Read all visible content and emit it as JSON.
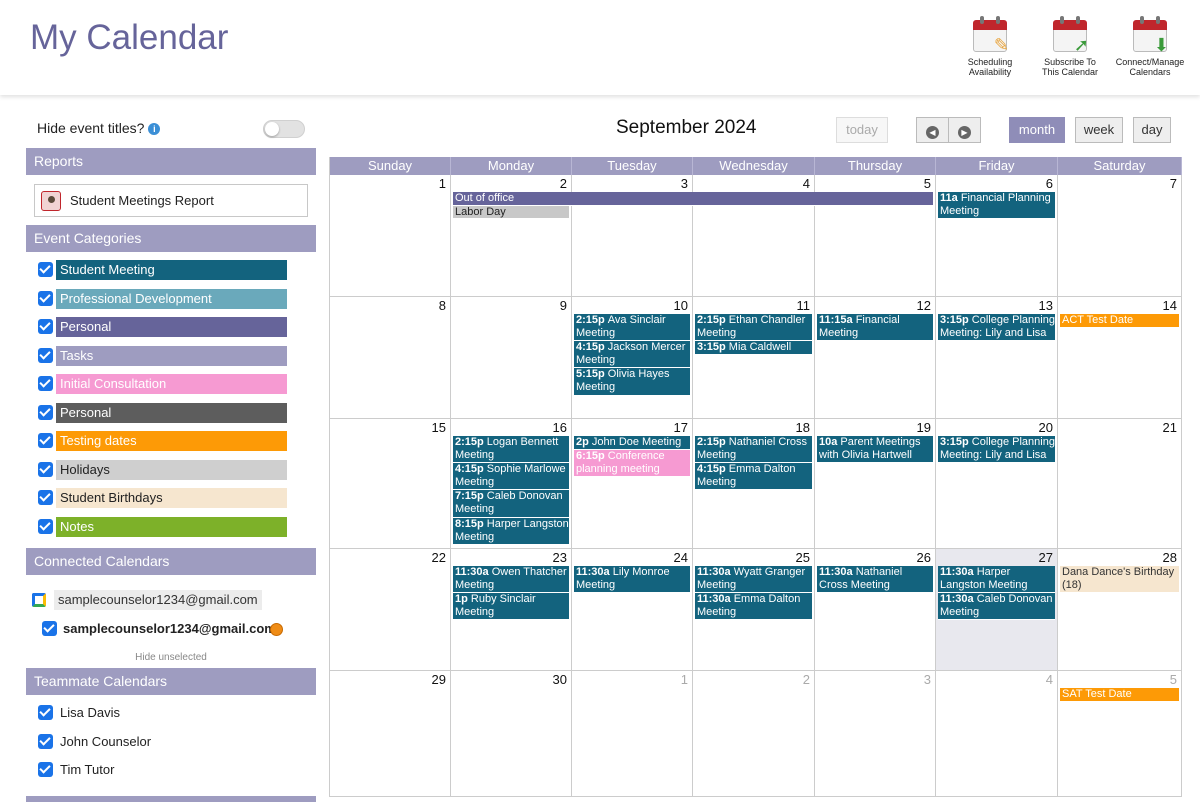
{
  "header": {
    "title": "My Calendar",
    "buttons": [
      {
        "label_line1": "Scheduling",
        "label_line2": "Availability",
        "icon": "calendar-pencil-icon"
      },
      {
        "label_line1": "Subscribe To",
        "label_line2": "This Calendar",
        "icon": "calendar-arrow-icon"
      },
      {
        "label_line1": "Connect/Manage",
        "label_line2": "Calendars",
        "icon": "calendar-download-icon"
      }
    ]
  },
  "sidebar": {
    "hide_titles_label": "Hide event titles?",
    "reports_header": "Reports",
    "report_item": "Student Meetings Report",
    "categories_header": "Event Categories",
    "categories": [
      {
        "label": "Student Meeting",
        "color": "#13637e"
      },
      {
        "label": "Professional Development",
        "color": "#6aa9bb"
      },
      {
        "label": "Personal",
        "color": "#66649a"
      },
      {
        "label": "Tasks",
        "color": "#9e9cc0"
      },
      {
        "label": "Initial Consultation",
        "color": "#f69ad2"
      },
      {
        "label": "Personal",
        "color": "#5d5d5d"
      },
      {
        "label": "Testing dates",
        "color": "#fd9a06"
      },
      {
        "label": "Holidays",
        "color": "#cfcfcf"
      },
      {
        "label": "Student Birthdays",
        "color": "#f6e6cf"
      },
      {
        "label": "Notes",
        "color": "#7db129"
      }
    ],
    "connected_header": "Connected Calendars",
    "connected_account": "samplecounselor1234@gmail.com",
    "connected_sub": "samplecounselor1234@gmail.com",
    "hide_unselected": "Hide unselected",
    "teammate_header": "Teammate Calendars",
    "teammates": [
      "Lisa Davis",
      "John Counselor",
      "Tim Tutor"
    ]
  },
  "calendar": {
    "title": "September 2024",
    "today_label": "today",
    "views": {
      "month": "month",
      "week": "week",
      "day": "day"
    },
    "days_of_week": [
      "Sunday",
      "Monday",
      "Tuesday",
      "Wednesday",
      "Thursday",
      "Friday",
      "Saturday"
    ],
    "weeks": [
      [
        "1",
        "2",
        "3",
        "4",
        "5",
        "6",
        "7"
      ],
      [
        "8",
        "9",
        "10",
        "11",
        "12",
        "13",
        "14"
      ],
      [
        "15",
        "16",
        "17",
        "18",
        "19",
        "20",
        "21"
      ],
      [
        "22",
        "23",
        "24",
        "25",
        "26",
        "27",
        "28"
      ],
      [
        "29",
        "30",
        "1",
        "2",
        "3",
        "4",
        "5"
      ]
    ],
    "events": [
      {
        "week": 0,
        "day": 1,
        "span": 4,
        "slot": 0,
        "lines": 1,
        "time": "",
        "title": "Out of office",
        "cls": "purple"
      },
      {
        "week": 0,
        "day": 1,
        "span": 1,
        "slot": 1,
        "lines": 1,
        "time": "",
        "title": "Labor Day",
        "cls": "gray"
      },
      {
        "week": 0,
        "day": 5,
        "span": 1,
        "slot": 0,
        "lines": 2,
        "time": "11a",
        "title": "Financial Planning Meeting",
        "cls": "teal"
      },
      {
        "week": 1,
        "day": 2,
        "span": 1,
        "slot": 0,
        "lines": 2,
        "time": "2:15p",
        "title": "Ava Sinclair Meeting",
        "cls": "teal"
      },
      {
        "week": 1,
        "day": 2,
        "span": 1,
        "slot": 2,
        "lines": 2,
        "time": "4:15p",
        "title": "Jackson Mercer Meeting",
        "cls": "teal"
      },
      {
        "week": 1,
        "day": 2,
        "span": 1,
        "slot": 4,
        "lines": 2,
        "time": "5:15p",
        "title": "Olivia Hayes Meeting",
        "cls": "teal"
      },
      {
        "week": 1,
        "day": 3,
        "span": 1,
        "slot": 0,
        "lines": 2,
        "time": "2:15p",
        "title": "Ethan Chandler Meeting",
        "cls": "teal"
      },
      {
        "week": 1,
        "day": 3,
        "span": 1,
        "slot": 2,
        "lines": 1,
        "time": "3:15p",
        "title": "Mia Caldwell",
        "cls": "teal"
      },
      {
        "week": 1,
        "day": 4,
        "span": 1,
        "slot": 0,
        "lines": 2,
        "time": "11:15a",
        "title": "Financial Meeting",
        "cls": "teal"
      },
      {
        "week": 1,
        "day": 5,
        "span": 1,
        "slot": 0,
        "lines": 2,
        "time": "3:15p",
        "title": "College Planning Meeting: Lily and Lisa",
        "cls": "teal"
      },
      {
        "week": 1,
        "day": 6,
        "span": 1,
        "slot": 0,
        "lines": 1,
        "time": "",
        "title": "ACT Test Date",
        "cls": "orange"
      },
      {
        "week": 2,
        "day": 1,
        "span": 1,
        "slot": 0,
        "lines": 2,
        "time": "2:15p",
        "title": "Logan Bennett Meeting",
        "cls": "teal"
      },
      {
        "week": 2,
        "day": 1,
        "span": 1,
        "slot": 2,
        "lines": 2,
        "time": "4:15p",
        "title": "Sophie Marlowe Meeting",
        "cls": "teal"
      },
      {
        "week": 2,
        "day": 1,
        "span": 1,
        "slot": 4,
        "lines": 2,
        "time": "7:15p",
        "title": "Caleb Donovan Meeting",
        "cls": "teal"
      },
      {
        "week": 2,
        "day": 1,
        "span": 1,
        "slot": 6,
        "lines": 2,
        "time": "8:15p",
        "title": "Harper Langston Meeting",
        "cls": "teal"
      },
      {
        "week": 2,
        "day": 2,
        "span": 1,
        "slot": 0,
        "lines": 1,
        "time": "2p",
        "title": "John Doe Meeting",
        "cls": "teal"
      },
      {
        "week": 2,
        "day": 2,
        "span": 1,
        "slot": 1,
        "lines": 2,
        "time": "6:15p",
        "title": "Conference planning meeting",
        "cls": "pink"
      },
      {
        "week": 2,
        "day": 3,
        "span": 1,
        "slot": 0,
        "lines": 2,
        "time": "2:15p",
        "title": "Nathaniel Cross Meeting",
        "cls": "teal"
      },
      {
        "week": 2,
        "day": 3,
        "span": 1,
        "slot": 2,
        "lines": 2,
        "time": "4:15p",
        "title": "Emma Dalton Meeting",
        "cls": "teal"
      },
      {
        "week": 2,
        "day": 4,
        "span": 1,
        "slot": 0,
        "lines": 2,
        "time": "10a",
        "title": "Parent Meetings with Olivia Hartwell",
        "cls": "teal"
      },
      {
        "week": 2,
        "day": 5,
        "span": 1,
        "slot": 0,
        "lines": 2,
        "time": "3:15p",
        "title": "College Planning Meeting: Lily and Lisa",
        "cls": "teal"
      },
      {
        "week": 3,
        "day": 1,
        "span": 1,
        "slot": 0,
        "lines": 2,
        "time": "11:30a",
        "title": "Owen Thatcher Meeting",
        "cls": "teal"
      },
      {
        "week": 3,
        "day": 1,
        "span": 1,
        "slot": 2,
        "lines": 2,
        "time": "1p",
        "title": "Ruby Sinclair Meeting",
        "cls": "teal"
      },
      {
        "week": 3,
        "day": 2,
        "span": 1,
        "slot": 0,
        "lines": 2,
        "time": "11:30a",
        "title": "Lily Monroe Meeting",
        "cls": "teal"
      },
      {
        "week": 3,
        "day": 3,
        "span": 1,
        "slot": 0,
        "lines": 2,
        "time": "11:30a",
        "title": "Wyatt Granger Meeting",
        "cls": "teal"
      },
      {
        "week": 3,
        "day": 3,
        "span": 1,
        "slot": 2,
        "lines": 2,
        "time": "11:30a",
        "title": "Emma Dalton Meeting",
        "cls": "teal"
      },
      {
        "week": 3,
        "day": 4,
        "span": 1,
        "slot": 0,
        "lines": 2,
        "time": "11:30a",
        "title": "Nathaniel Cross Meeting",
        "cls": "teal"
      },
      {
        "week": 3,
        "day": 5,
        "span": 1,
        "slot": 0,
        "lines": 2,
        "time": "11:30a",
        "title": "Harper Langston Meeting",
        "cls": "teal"
      },
      {
        "week": 3,
        "day": 5,
        "span": 1,
        "slot": 2,
        "lines": 2,
        "time": "11:30a",
        "title": "Caleb Donovan Meeting",
        "cls": "teal"
      },
      {
        "week": 3,
        "day": 6,
        "span": 1,
        "slot": 0,
        "lines": 2,
        "time": "",
        "title": "Dana Dance's Birthday (18)",
        "cls": "beige"
      },
      {
        "week": 4,
        "day": 6,
        "span": 1,
        "slot": 0,
        "lines": 1,
        "time": "",
        "title": "SAT Test Date",
        "cls": "orange"
      }
    ]
  }
}
